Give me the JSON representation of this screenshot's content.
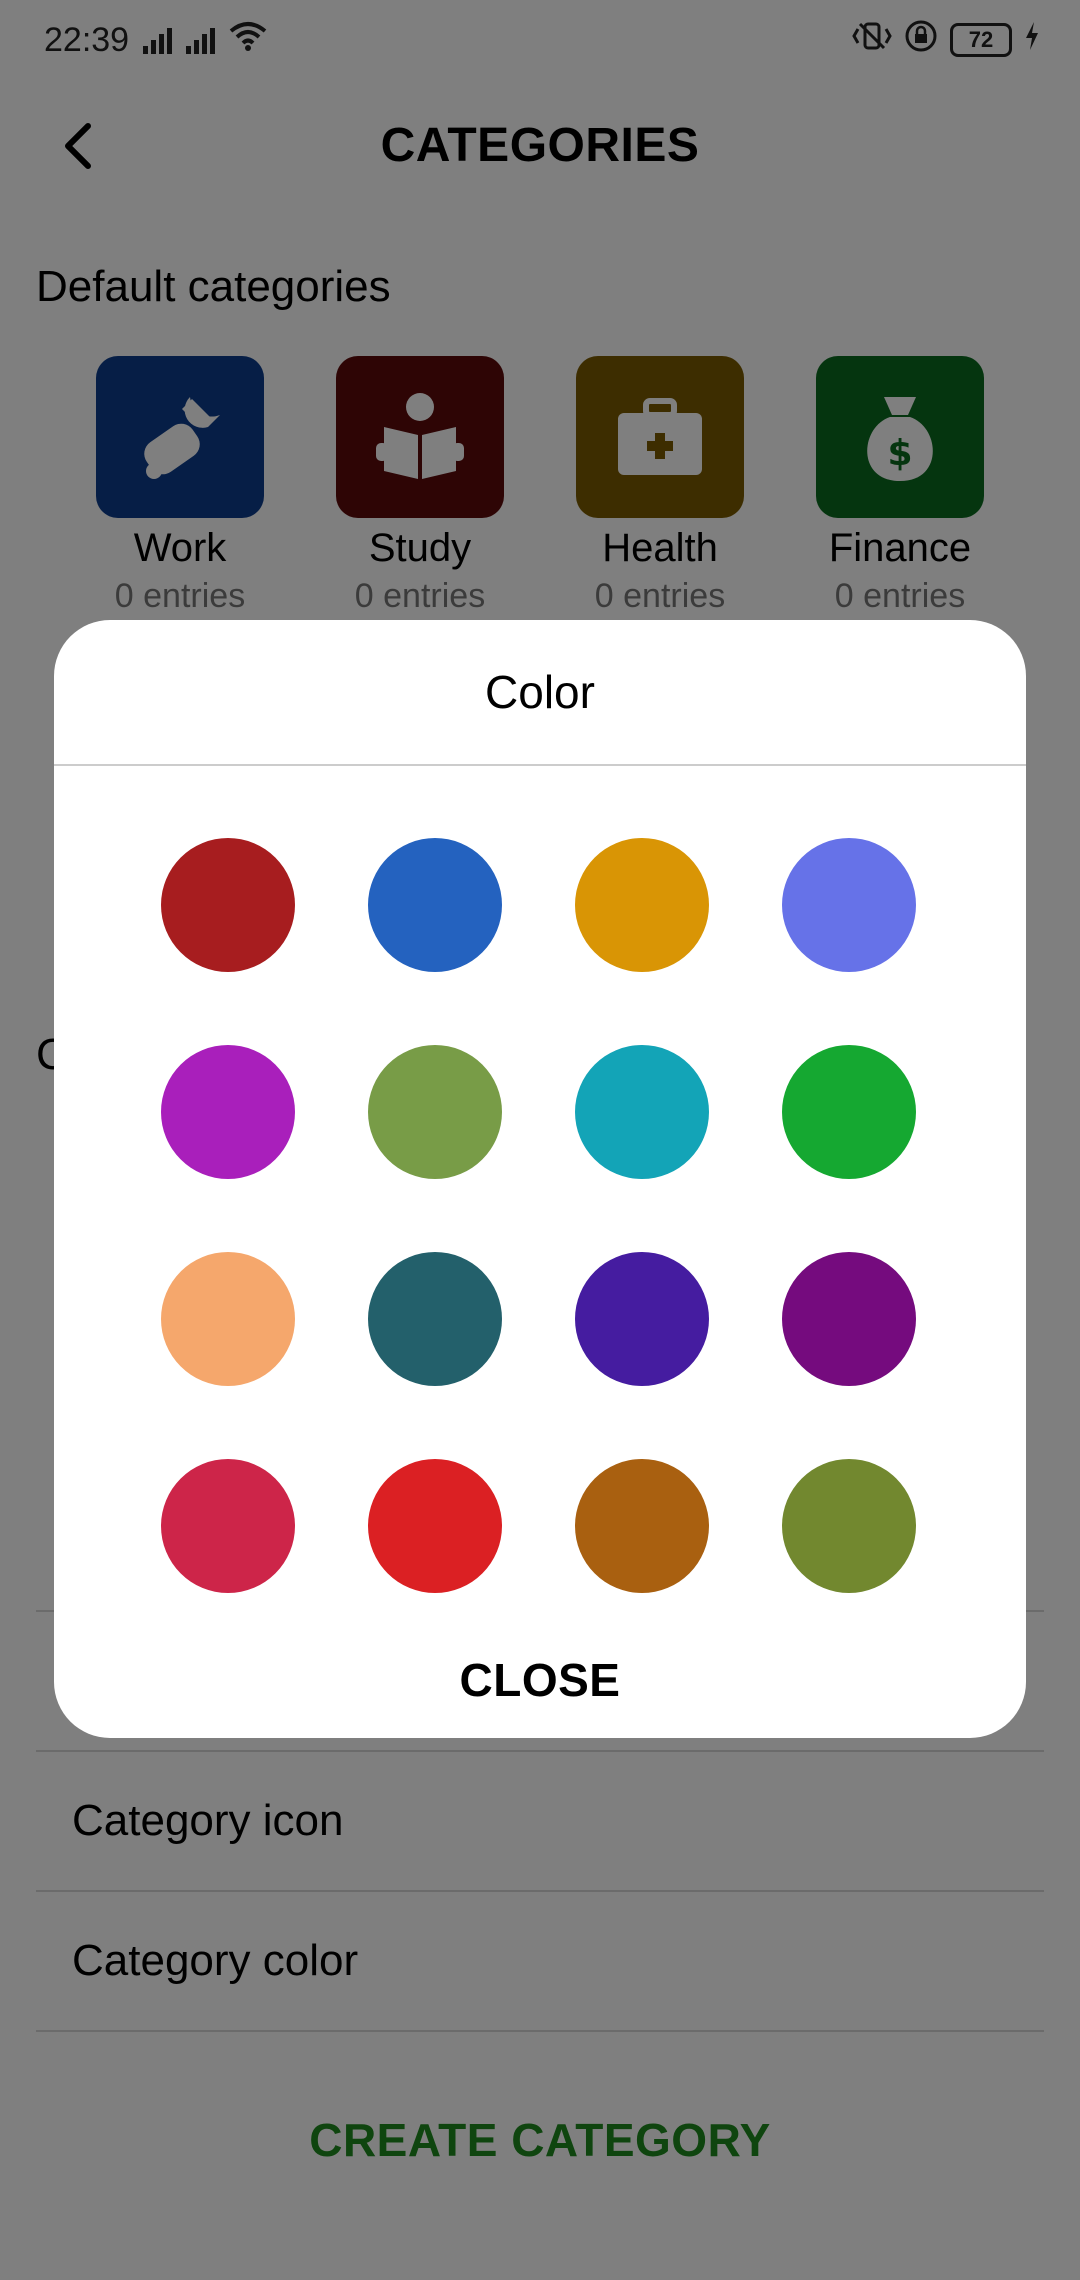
{
  "status_bar": {
    "time": "22:39",
    "battery": "72",
    "icons": [
      "signal-icon",
      "signal-icon",
      "wifi-icon",
      "vibrate-icon",
      "rotation-lock-icon",
      "battery-icon",
      "charging-icon"
    ]
  },
  "app_bar": {
    "title": "CATEGORIES",
    "back_icon": "chevron-left-icon"
  },
  "default_section": {
    "title": "Default categories",
    "categories": [
      {
        "name": "Work",
        "count": "0 entries",
        "icon": "wrench-hand-icon",
        "color": "#0c3c8c"
      },
      {
        "name": "Study",
        "count": "0 entries",
        "icon": "reading-icon",
        "color": "#5c0a0a"
      },
      {
        "name": "Health",
        "count": "0 entries",
        "icon": "first-aid-kit-icon",
        "color": "#7a5a00"
      },
      {
        "name": "Finance",
        "count": "0 entries",
        "icon": "money-bag-icon",
        "color": "#0a6a1e"
      }
    ]
  },
  "custom_section": {
    "title": "C"
  },
  "sheet": {
    "rows": [
      "",
      "Category icon",
      "Category color"
    ],
    "create_label": "CREATE CATEGORY",
    "create_color": "#1e8a1e"
  },
  "dialog": {
    "title": "Color",
    "close_label": "CLOSE",
    "colors": [
      "#a71d1f",
      "#2462bf",
      "#d99505",
      "#6672e8",
      "#a91fbb",
      "#789c47",
      "#13a4b7",
      "#15a831",
      "#f5a76c",
      "#23606b",
      "#451ca0",
      "#750b7e",
      "#cd2549",
      "#db2023",
      "#a96010",
      "#72882f"
    ]
  }
}
